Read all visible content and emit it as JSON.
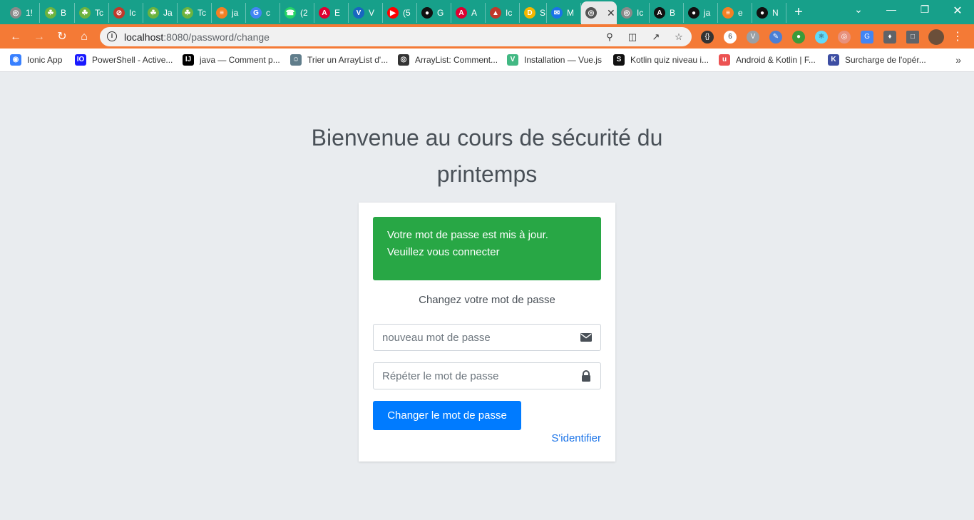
{
  "tabs": [
    {
      "label": "1!",
      "icon": "globe-icon",
      "color": "#8a8a8a"
    },
    {
      "label": "B",
      "icon": "spring-leaf-icon",
      "color": "#6db33f"
    },
    {
      "label": "Tc",
      "icon": "spring-leaf-icon",
      "color": "#6db33f"
    },
    {
      "label": "Ic",
      "icon": "blocked-icon",
      "color": "#c0392b"
    },
    {
      "label": "Ja",
      "icon": "spring-leaf-icon",
      "color": "#6db33f"
    },
    {
      "label": "Tc",
      "icon": "spring-leaf-icon",
      "color": "#6db33f"
    },
    {
      "label": "ja",
      "icon": "stackoverflow-icon",
      "color": "#f48024"
    },
    {
      "label": "c",
      "icon": "google-icon",
      "color": "#4285f4"
    },
    {
      "label": "(2",
      "icon": "whatsapp-icon",
      "color": "#25d366"
    },
    {
      "label": "E",
      "icon": "angular-icon",
      "color": "#dd0031"
    },
    {
      "label": "V",
      "icon": "vuetify-icon",
      "color": "#1867c0"
    },
    {
      "label": "(5",
      "icon": "youtube-icon",
      "color": "#ff0000"
    },
    {
      "label": "G",
      "icon": "github-icon",
      "color": "#111111"
    },
    {
      "label": "A",
      "icon": "angular-icon",
      "color": "#dd0031"
    },
    {
      "label": "Ic",
      "icon": "maven-icon",
      "color": "#c0392b"
    },
    {
      "label": "S",
      "icon": "d-icon",
      "color": "#f5b700"
    },
    {
      "label": "M",
      "icon": "mail-icon",
      "color": "#1a73e8"
    },
    {
      "label": "",
      "icon": "globe-icon",
      "color": "#555555",
      "active": true
    },
    {
      "label": "Ic",
      "icon": "globe-icon",
      "color": "#8a8a8a"
    },
    {
      "label": "B",
      "icon": "angular-icon",
      "color": "#111111"
    },
    {
      "label": "ja",
      "icon": "github-icon",
      "color": "#111111"
    },
    {
      "label": "e",
      "icon": "stackoverflow-icon",
      "color": "#f48024"
    },
    {
      "label": "N",
      "icon": "github-icon",
      "color": "#111111"
    }
  ],
  "address_bar": {
    "host": "localhost",
    "path": ":8080/password/change"
  },
  "bookmarks": [
    {
      "label": "Ionic App",
      "icon": "ionic-icon",
      "color": "#3880ff"
    },
    {
      "label": "PowerShell - Active...",
      "icon": "io-icon",
      "color": "#1a1aff"
    },
    {
      "label": "java — Comment p...",
      "icon": "intellij-icon",
      "color": "#000000"
    },
    {
      "label": "Trier un ArrayList d'...",
      "icon": "robot-icon",
      "color": "#607d8b"
    },
    {
      "label": "ArrayList: Comment...",
      "icon": "globe-icon",
      "color": "#333333"
    },
    {
      "label": "Installation — Vue.js",
      "icon": "vue-icon",
      "color": "#42b883"
    },
    {
      "label": "Kotlin quiz niveau i...",
      "icon": "kotlin-icon",
      "color": "#111111"
    },
    {
      "label": "Android & Kotlin | F...",
      "icon": "udemy-icon",
      "color": "#ec5252"
    },
    {
      "label": "Surcharge de l'opér...",
      "icon": "kotlin-book-icon",
      "color": "#3d4ea3"
    }
  ],
  "page": {
    "title": "Bienvenue au cours de sécurité du printemps",
    "alert": "Votre mot de passe est mis à jour. Veuillez vous connecter",
    "subtitle": "Changez votre mot de passe",
    "new_password_placeholder": "nouveau mot de passe",
    "repeat_password_placeholder": "Répéter le mot de passe",
    "submit_label": "Changer le mot de passe",
    "login_link": "S'identifier"
  },
  "colors": {
    "tab_strip": "#17a08a",
    "toolbar": "#f47a36",
    "page_background": "#e9ecef",
    "success_alert": "#28a745",
    "primary_button": "#007bff",
    "link": "#1a73e8"
  }
}
